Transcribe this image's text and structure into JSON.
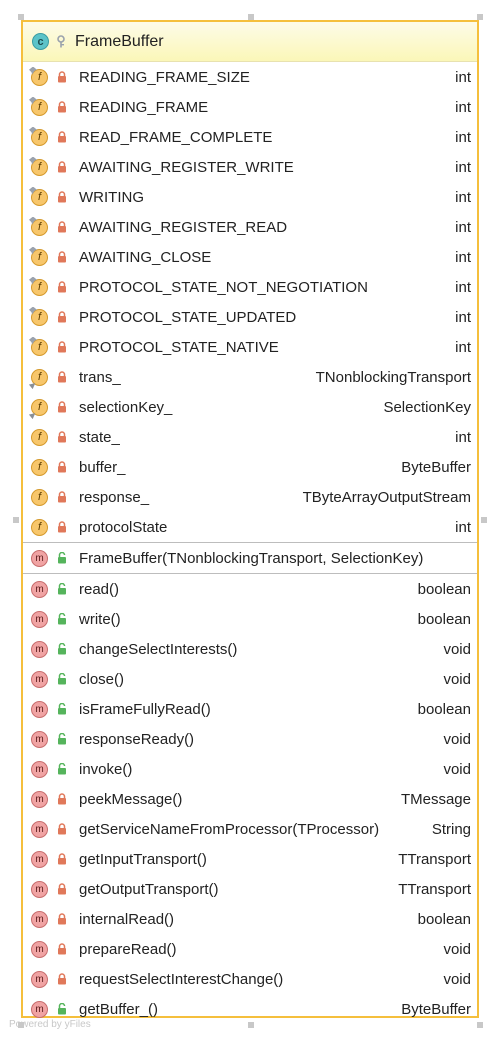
{
  "class": {
    "name": "FrameBuffer",
    "badge_letter": "c",
    "badge_color": "#5cc3c8",
    "border_color": "#f5bf3c"
  },
  "fields": [
    {
      "name": "READING_FRAME_SIZE",
      "type": "int",
      "static": true,
      "vis": "private"
    },
    {
      "name": "READING_FRAME",
      "type": "int",
      "static": true,
      "vis": "private"
    },
    {
      "name": "READ_FRAME_COMPLETE",
      "type": "int",
      "static": true,
      "vis": "private"
    },
    {
      "name": "AWAITING_REGISTER_WRITE",
      "type": "int",
      "static": true,
      "vis": "private"
    },
    {
      "name": "WRITING",
      "type": "int",
      "static": true,
      "vis": "private"
    },
    {
      "name": "AWAITING_REGISTER_READ",
      "type": "int",
      "static": true,
      "vis": "private"
    },
    {
      "name": "AWAITING_CLOSE",
      "type": "int",
      "static": true,
      "vis": "private"
    },
    {
      "name": "PROTOCOL_STATE_NOT_NEGOTIATION",
      "type": "int",
      "static": true,
      "vis": "private"
    },
    {
      "name": "PROTOCOL_STATE_UPDATED",
      "type": "int",
      "static": true,
      "vis": "private"
    },
    {
      "name": "PROTOCOL_STATE_NATIVE",
      "type": "int",
      "static": true,
      "vis": "private"
    },
    {
      "name": "trans_",
      "type": "TNonblockingTransport",
      "static": false,
      "final": true,
      "vis": "private"
    },
    {
      "name": "selectionKey_",
      "type": "SelectionKey",
      "static": false,
      "final": true,
      "vis": "private"
    },
    {
      "name": "state_",
      "type": "int",
      "static": false,
      "vis": "private"
    },
    {
      "name": "buffer_",
      "type": "ByteBuffer",
      "static": false,
      "vis": "private"
    },
    {
      "name": "response_",
      "type": "TByteArrayOutputStream",
      "static": false,
      "vis": "private"
    },
    {
      "name": "protocolState",
      "type": "int",
      "static": false,
      "vis": "private"
    }
  ],
  "constructors": [
    {
      "name": "FrameBuffer(TNonblockingTransport, SelectionKey)",
      "type": "",
      "vis": "public"
    }
  ],
  "methods": [
    {
      "name": "read()",
      "type": "boolean",
      "vis": "public"
    },
    {
      "name": "write()",
      "type": "boolean",
      "vis": "public"
    },
    {
      "name": "changeSelectInterests()",
      "type": "void",
      "vis": "public"
    },
    {
      "name": "close()",
      "type": "void",
      "vis": "public"
    },
    {
      "name": "isFrameFullyRead()",
      "type": "boolean",
      "vis": "public"
    },
    {
      "name": "responseReady()",
      "type": "void",
      "vis": "public"
    },
    {
      "name": "invoke()",
      "type": "void",
      "vis": "public"
    },
    {
      "name": "peekMessage()",
      "type": "TMessage",
      "vis": "private"
    },
    {
      "name": "getServiceNameFromProcessor(TProcessor)",
      "type": "String",
      "vis": "private"
    },
    {
      "name": "getInputTransport()",
      "type": "TTransport",
      "vis": "private"
    },
    {
      "name": "getOutputTransport()",
      "type": "TTransport",
      "vis": "private"
    },
    {
      "name": "internalRead()",
      "type": "boolean",
      "vis": "private"
    },
    {
      "name": "prepareRead()",
      "type": "void",
      "vis": "private"
    },
    {
      "name": "requestSelectInterestChange()",
      "type": "void",
      "vis": "private"
    },
    {
      "name": "getBuffer_()",
      "type": "ByteBuffer",
      "vis": "public"
    }
  ],
  "watermark": "Powered by yFiles"
}
